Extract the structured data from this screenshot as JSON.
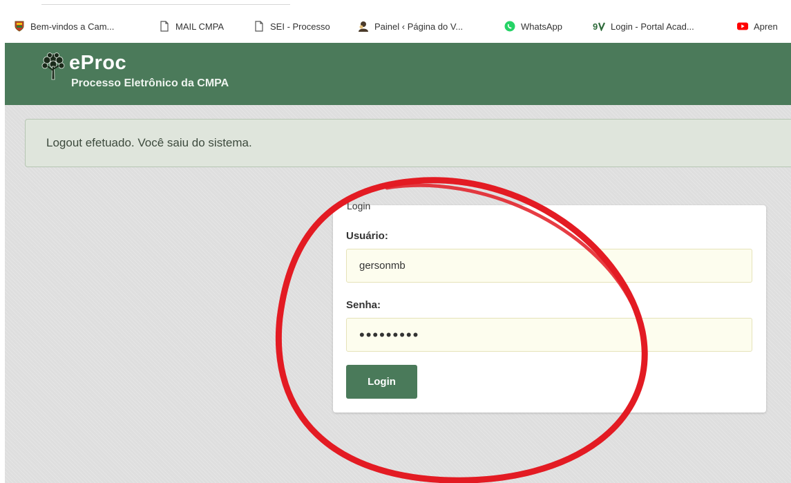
{
  "bookmarks": [
    {
      "label": "Bem-vindos a Cam...",
      "icon": "crest-icon"
    },
    {
      "label": "MAIL CMPA",
      "icon": "page-icon"
    },
    {
      "label": "SEI - Processo",
      "icon": "page-icon"
    },
    {
      "label": "Painel ‹ Página do V...",
      "icon": "person-icon"
    },
    {
      "label": "WhatsApp",
      "icon": "whatsapp-icon"
    },
    {
      "label": "Login - Portal Acad...",
      "icon": "gv-icon"
    },
    {
      "label": "Apren",
      "icon": "youtube-icon"
    }
  ],
  "header": {
    "title": "eProc",
    "subtitle": "Processo Eletrônico da CMPA",
    "background_color": "#4b7a5a"
  },
  "alert": {
    "message": "Logout efetuado. Você saiu do sistema."
  },
  "login_form": {
    "legend": "Login",
    "username_label": "Usuário:",
    "username_value": "gersonmb",
    "password_label": "Senha:",
    "password_value": "•••••••••",
    "submit_label": "Login",
    "button_color": "#4a7a5a"
  },
  "annotation": {
    "color": "#e31b23",
    "shape": "ellipse"
  }
}
